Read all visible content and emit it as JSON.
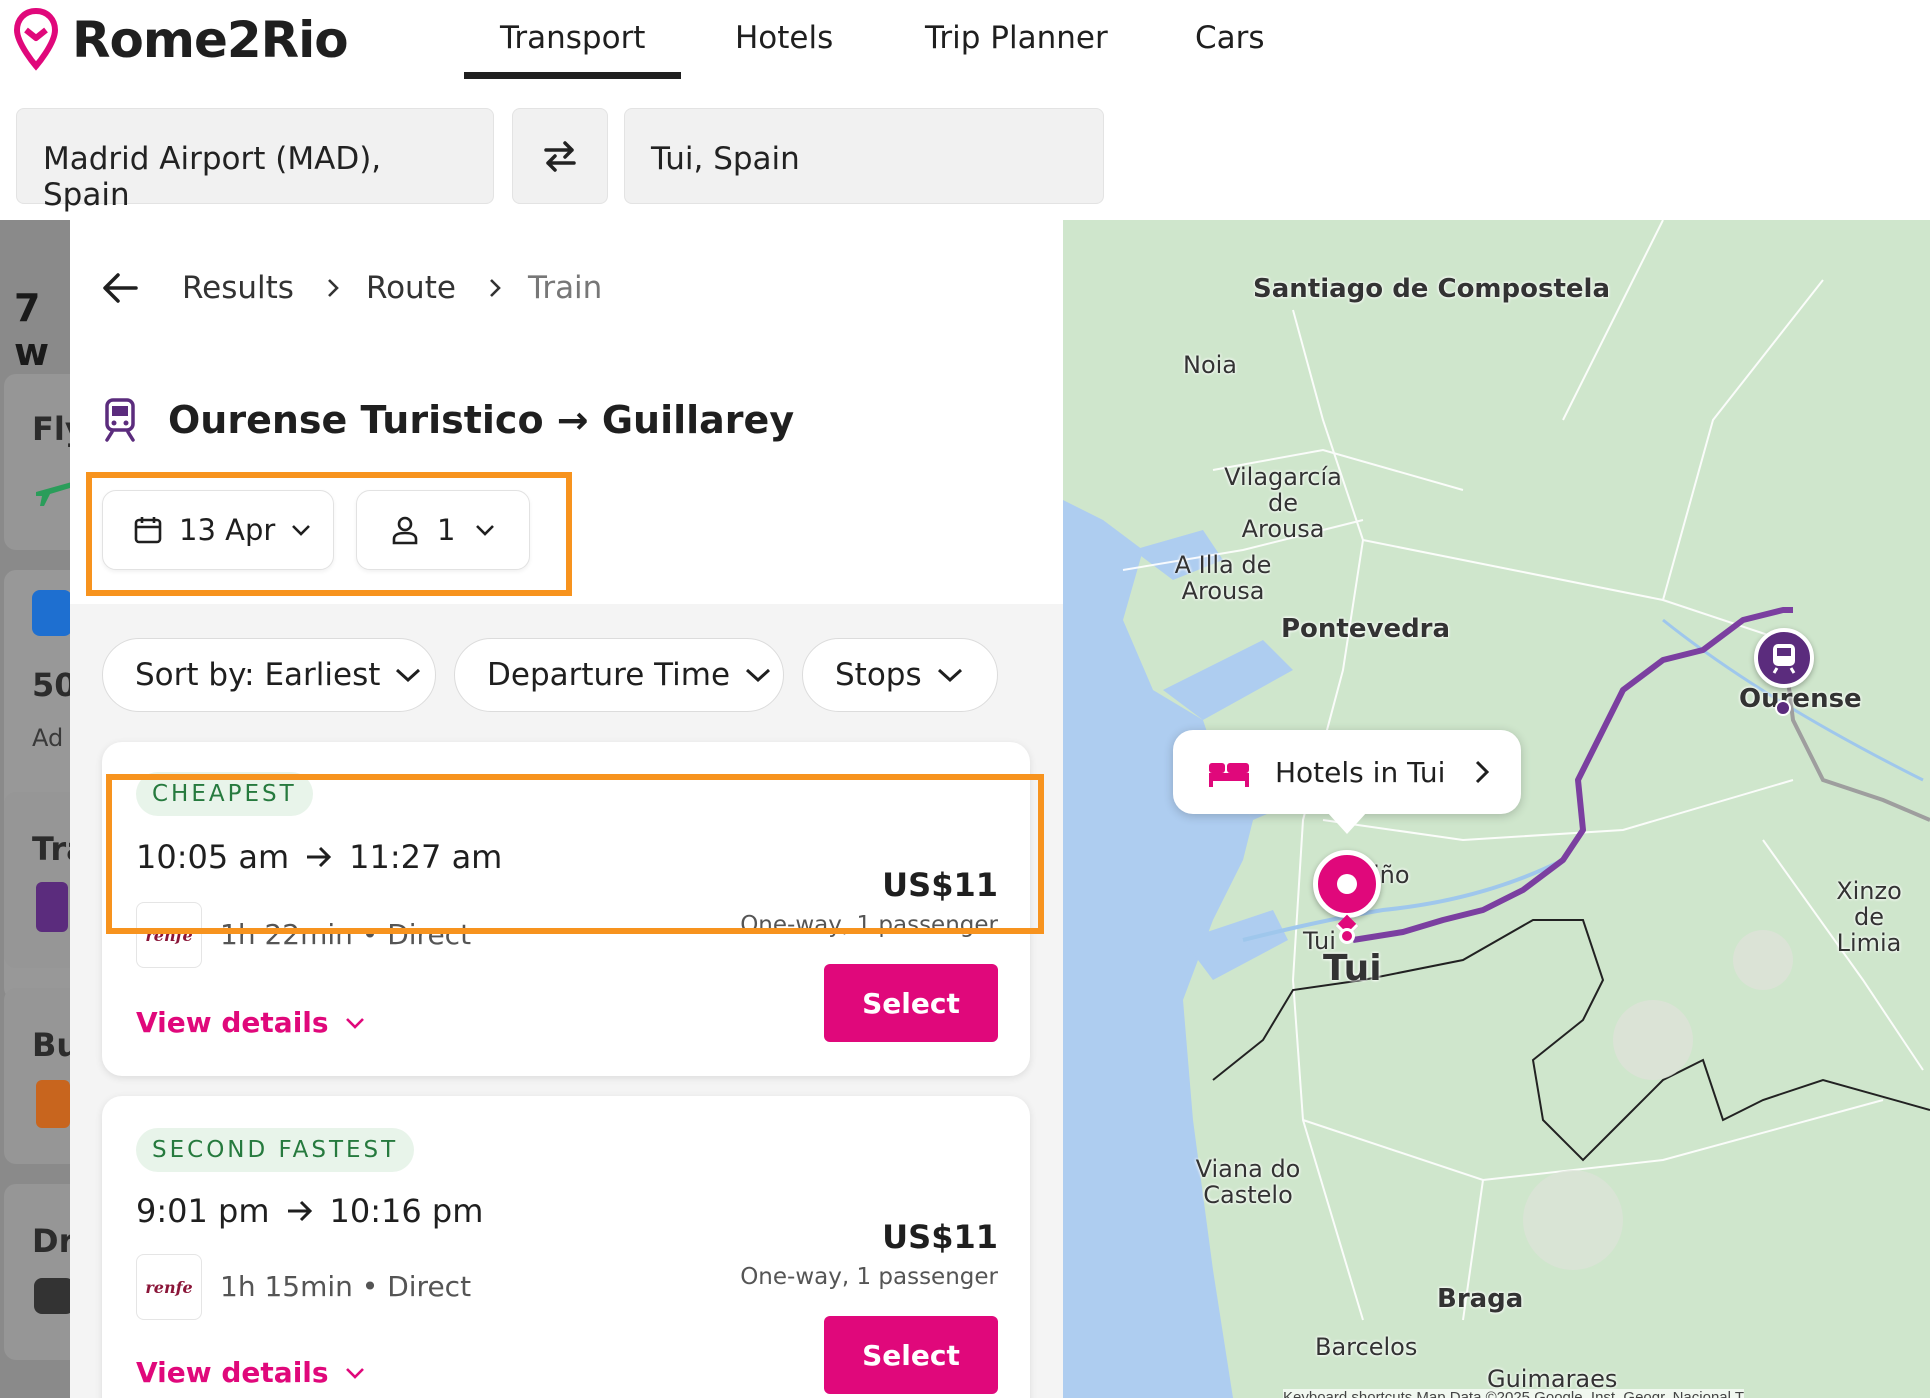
{
  "app": {
    "name": "Rome2Rio"
  },
  "nav": {
    "tabs": [
      {
        "label": "Transport",
        "active": true
      },
      {
        "label": "Hotels"
      },
      {
        "label": "Trip Planner"
      },
      {
        "label": "Cars"
      }
    ]
  },
  "search": {
    "origin": "Madrid Airport (MAD), Spain",
    "destination": "Tui, Spain"
  },
  "background": {
    "heading": "7 w",
    "items": [
      "Fly",
      "50",
      "Ad",
      "Tra",
      "Bu",
      "Dri"
    ]
  },
  "breadcrumb": {
    "items": [
      "Results",
      "Route",
      "Train"
    ]
  },
  "route": {
    "title": "Ourense Turistico → Guillarey"
  },
  "controls": {
    "date": "13 Apr",
    "passengers": "1"
  },
  "filters": {
    "sort": "Sort by: Earliest",
    "departure": "Departure Time",
    "stops": "Stops"
  },
  "results": [
    {
      "badge": "CHEAPEST",
      "depart": "10:05 am",
      "arrive": "11:27 am",
      "operator": "renfe",
      "duration": "1h 22min • Direct",
      "price": "US$11",
      "price_note": "One-way, 1 passenger",
      "view_details": "View details",
      "select": "Select"
    },
    {
      "badge": "SECOND FASTEST",
      "depart": "9:01 pm",
      "arrive": "10:16 pm",
      "operator": "renfe",
      "duration": "1h 15min • Direct",
      "price": "US$11",
      "price_note": "One-way, 1 passenger",
      "view_details": "View details",
      "select": "Select"
    }
  ],
  "map": {
    "hotel_popup": "Hotels in Tui",
    "cities": [
      "Santiago de Compostela",
      "Noia",
      "Vilagarcía de Arousa",
      "A Illa de Arousa",
      "Pontevedra",
      "Ourense",
      "Xinzo de Limia",
      "Tui",
      "Tui",
      "Viana do Castelo",
      "Braga",
      "Barcelos",
      "Guimaraes",
      "iño"
    ],
    "footer": "Keyboard shortcuts   Map Data ©2025 Google, Inst. Geogr. Nacional   T"
  },
  "colors": {
    "accent": "#e0087b",
    "highlight": "#f7931e",
    "route": "#7b3fa0",
    "badge_text": "#267a3e"
  }
}
